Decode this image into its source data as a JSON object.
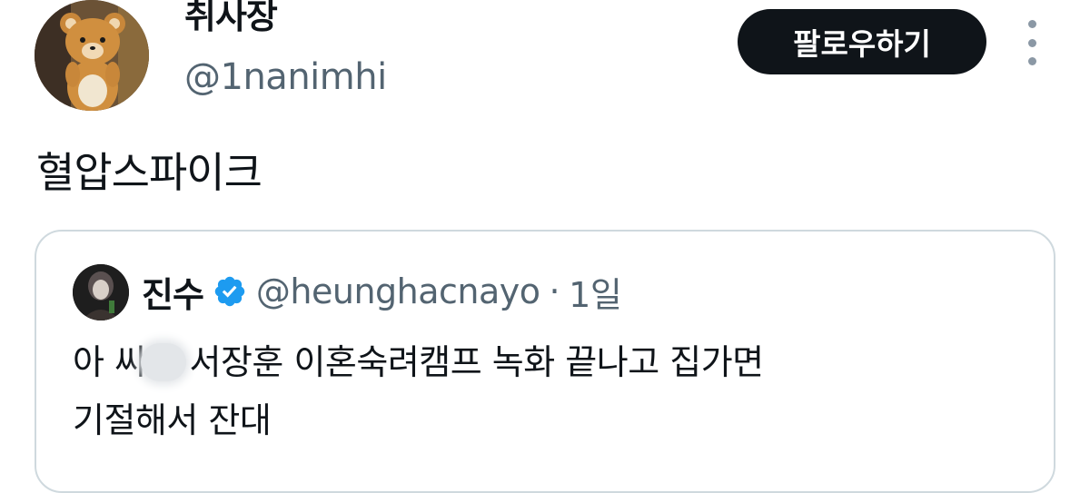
{
  "author": {
    "display_name": "취사장",
    "handle": "@1nanimhi",
    "avatar": "teddy-bear-avatar"
  },
  "follow_button": {
    "label": "팔로우하기"
  },
  "more_icon": "vertical-ellipsis-icon",
  "tweet": {
    "text": "혈압스파이크"
  },
  "quoted_tweet": {
    "display_name": "진수",
    "verified": true,
    "verified_color": "#1d9bf0",
    "handle": "@heunghacnayo",
    "separator": "·",
    "time": "1일",
    "text_line1_part1": "아 씨",
    "text_line1_part2": "서장훈 이혼숙려캠프 녹화 끝나고 집가면",
    "text_line2": "기절해서 잔대"
  },
  "colors": {
    "text": "#0f1419",
    "secondary": "#536471",
    "border": "#cfd9de",
    "button_bg": "#0f1419"
  }
}
